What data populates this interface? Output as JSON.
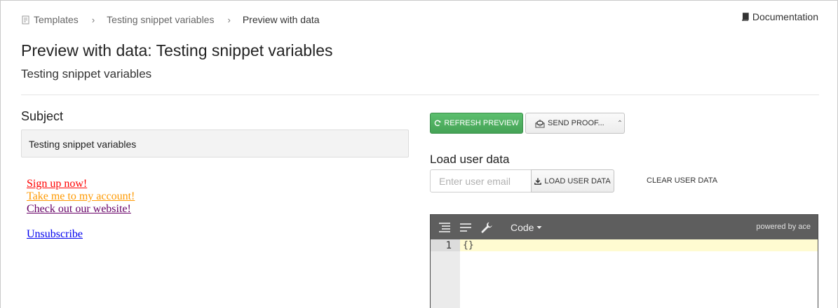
{
  "breadcrumb": {
    "items": [
      {
        "label": "Templates"
      },
      {
        "label": "Testing snippet variables"
      },
      {
        "label": "Preview with data"
      }
    ]
  },
  "header": {
    "documentation_label": "Documentation",
    "title": "Preview with data: Testing snippet variables",
    "subtitle": "Testing snippet variables"
  },
  "subject": {
    "label": "Subject",
    "value": "Testing snippet variables"
  },
  "preview": {
    "links": [
      {
        "label": "Sign up now!",
        "color": "#ff0000"
      },
      {
        "label": "Take me to my account!",
        "color": "#ff9900"
      },
      {
        "label": "Check out our website!",
        "color": "#660066"
      },
      {
        "label": "Unsubscribe",
        "color": "#0000ee"
      }
    ]
  },
  "actions": {
    "refresh_label": "REFRESH PREVIEW",
    "send_proof_label": "SEND PROOF..."
  },
  "user_data": {
    "label": "Load user data",
    "email_placeholder": "Enter user email",
    "load_label": "LOAD USER DATA",
    "clear_label": "CLEAR USER DATA"
  },
  "editor": {
    "mode_label": "Code",
    "powered_by": "powered by ace",
    "line_number": "1",
    "content": "{}"
  },
  "colors": {
    "refresh_button": "#4caf5e",
    "editor_toolbar": "#5e5e5e",
    "active_line": "#fffbd1"
  }
}
